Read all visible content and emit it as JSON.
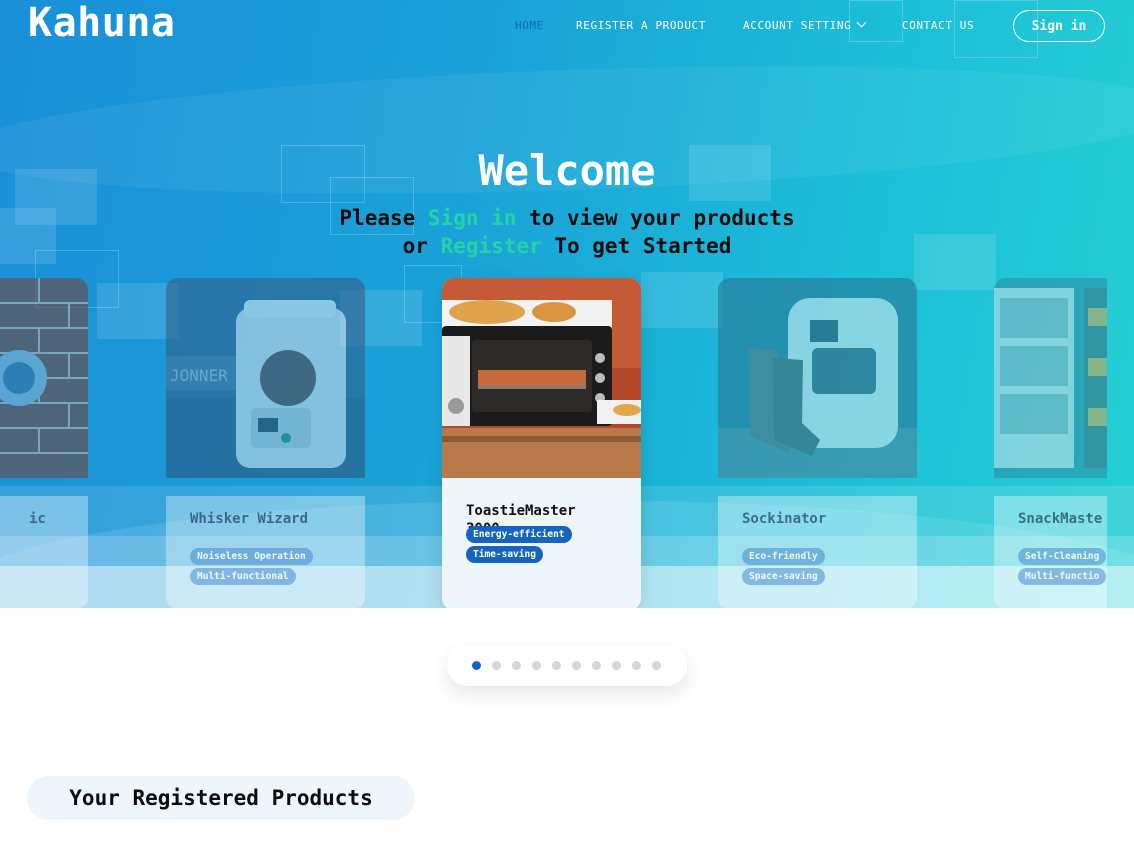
{
  "header": {
    "logo": "Kahuna",
    "nav": [
      {
        "label": "HOME",
        "active": true
      },
      {
        "label": "REGISTER A PRODUCT"
      },
      {
        "label": "ACCOUNT SETTING"
      },
      {
        "label": "CONTACT US"
      }
    ],
    "sign_in_label": "Sign in"
  },
  "hero": {
    "title": "Welcome",
    "line1_pre": "Please ",
    "line1_link": "Sign in",
    "line1_post": " to view your products",
    "line2_pre": "or ",
    "line2_link": "Register",
    "line2_post": " To get Started"
  },
  "carousel": {
    "cards": [
      {
        "name": "ic",
        "tags": []
      },
      {
        "name": "Whisker Wizard",
        "tags": [
          "Noiseless Operation",
          "Multi-functional"
        ]
      },
      {
        "name": "ToastieMaster 3000",
        "tags": [
          "Energy-efficient",
          "Time-saving"
        ]
      },
      {
        "name": "Sockinator",
        "tags": [
          "Eco-friendly",
          "Space-saving"
        ]
      },
      {
        "name": "SnackMaste",
        "tags": [
          "Self-Cleaning",
          "Multi-functio"
        ]
      }
    ],
    "active_index": 0,
    "dot_count": 10
  },
  "registered": {
    "title": "Your Registered Products"
  },
  "colors": {
    "accent": "#1565c0",
    "highlight": "#24d3a8",
    "hero_start": "#1a8fd8",
    "hero_end": "#26d0d4"
  }
}
